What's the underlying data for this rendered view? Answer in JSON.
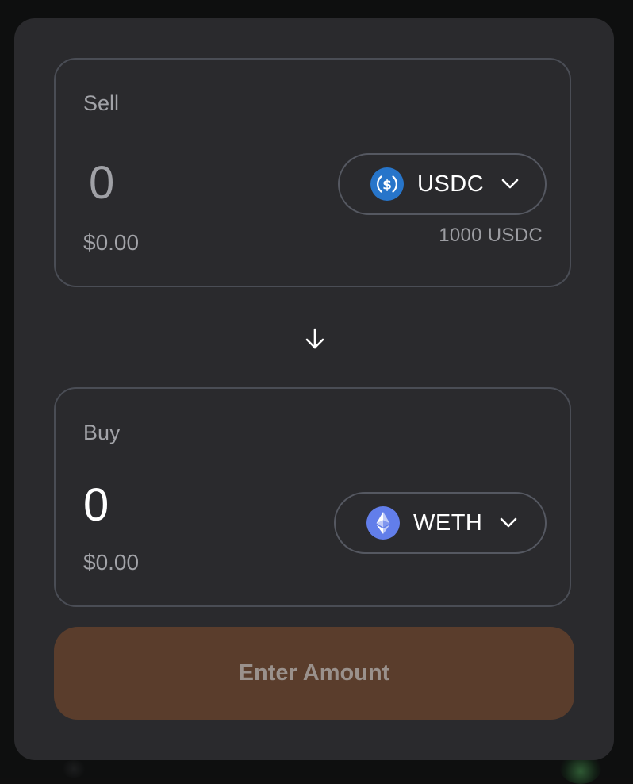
{
  "sell": {
    "label": "Sell",
    "amount_value": "",
    "amount_placeholder": "0",
    "usd_value": "$0.00",
    "token": {
      "symbol": "USDC",
      "icon": "usdc-icon",
      "icon_color": "#2775CA"
    },
    "balance": "1000 USDC"
  },
  "switch": {
    "icon": "arrow-down-icon"
  },
  "buy": {
    "label": "Buy",
    "amount_value": "0",
    "usd_value": "$0.00",
    "token": {
      "symbol": "WETH",
      "icon": "weth-icon",
      "icon_color": "#627EEA"
    }
  },
  "cta": {
    "label": "Enter Amount",
    "background": "#5a3d2c"
  },
  "colors": {
    "card": "#2a2a2d",
    "panel_border": "#4a4d55",
    "muted_text": "#a2a3a8",
    "primary_text": "#ffffff"
  }
}
